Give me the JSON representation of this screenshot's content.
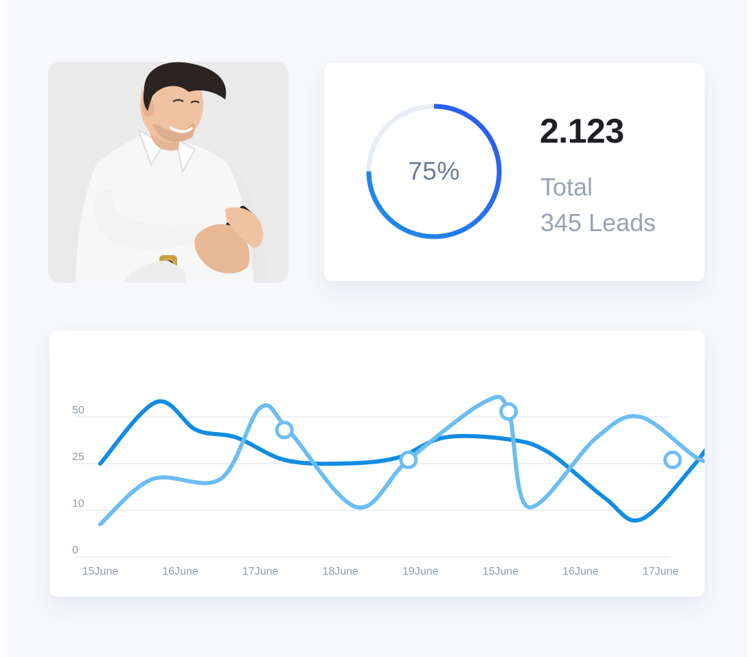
{
  "stats": {
    "progress_percent": 75,
    "progress_label": "75%",
    "total_value": "2.123",
    "total_label": "Total",
    "leads_label": "345 Leads"
  },
  "colors": {
    "page_background": "#f7f8fb",
    "card": "#ffffff",
    "ring_start": "#1e90e8",
    "ring_end": "#2d55f5",
    "ring_track": "#e8edf3",
    "series_dark": "#118ce2",
    "series_light": "#6cbdf4",
    "grid": "#e7eaf0"
  },
  "chart_data": {
    "type": "line",
    "categories": [
      "15June",
      "16June",
      "17June",
      "18June",
      "19June",
      "15June",
      "16June",
      "17June"
    ],
    "y_ticks": [
      "0",
      "10",
      "25",
      "50"
    ],
    "grid": true,
    "series": [
      {
        "color": "#118ce2",
        "values": [
          25,
          58,
          43,
          39,
          27,
          25,
          28,
          39,
          38,
          31,
          14,
          8,
          24,
          50
        ],
        "x": [
          0,
          0.7,
          1.2,
          1.7,
          2.3,
          3.0,
          3.7,
          4.3,
          5.1,
          5.6,
          6.3,
          6.75,
          7.4,
          7.85
        ],
        "markers": []
      },
      {
        "color": "#6cbdf4",
        "values": [
          7,
          20,
          20,
          55,
          43,
          11,
          27,
          58,
          53,
          11,
          39,
          50,
          27,
          30
        ],
        "x": [
          0,
          0.65,
          1.5,
          2.0,
          2.35,
          3.2,
          3.85,
          4.8,
          5.1,
          5.35,
          6.2,
          6.75,
          7.5,
          7.85
        ],
        "markers": [
          {
            "x": 2.3,
            "y": 43
          },
          {
            "x": 3.85,
            "y": 27
          },
          {
            "x": 5.1,
            "y": 53
          },
          {
            "x": 7.15,
            "y": 27
          }
        ]
      }
    ]
  }
}
